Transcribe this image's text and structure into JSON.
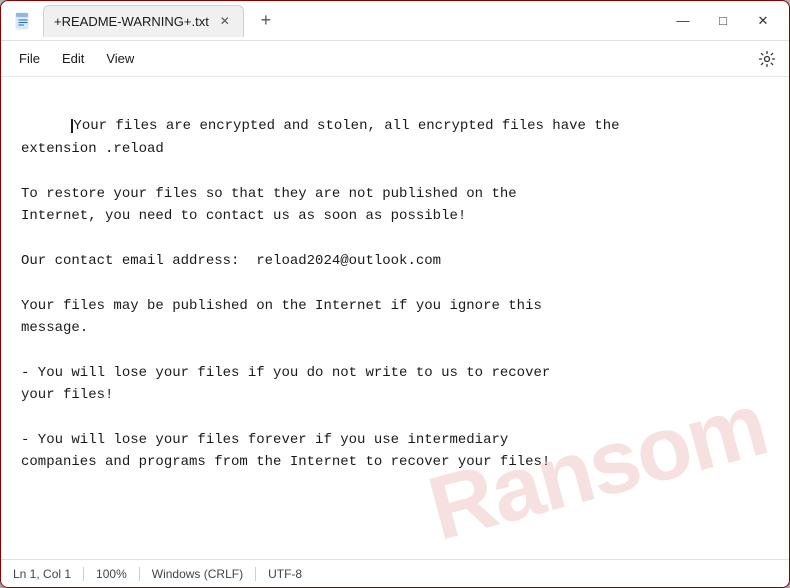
{
  "window": {
    "title": "+README-WARNING+.txt"
  },
  "menu": {
    "file_label": "File",
    "edit_label": "Edit",
    "view_label": "View"
  },
  "content": {
    "paragraph1": "Your files are encrypted and stolen, all encrypted files have the\nextension .reload",
    "paragraph2": "To restore your files so that they are not published on the\nInternet, you need to contact us as soon as possible!",
    "paragraph3": "Our contact email address:  reload2024@outlook.com",
    "paragraph4": "Your files may be published on the Internet if you ignore this\nmessage.",
    "paragraph5": "- You will lose your files if you do not write to us to recover\nyour files!",
    "paragraph6": "- You will lose your files forever if you use intermediary\ncompanies and programs from the Internet to recover your files!"
  },
  "statusbar": {
    "position": "Ln 1, Col 1",
    "zoom": "100%",
    "line_ending": "Windows (CRLF)",
    "encoding": "UTF-8"
  },
  "watermark": {
    "text": "Ransom"
  },
  "controls": {
    "minimize": "—",
    "maximize": "□",
    "close": "✕",
    "new_tab": "+",
    "tab_close": "✕"
  }
}
